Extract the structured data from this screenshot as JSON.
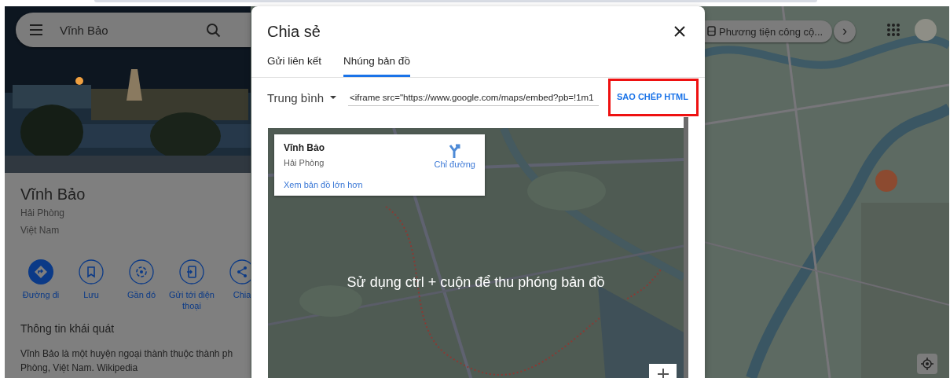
{
  "search": {
    "value": "Vĩnh Bảo"
  },
  "place": {
    "name": "Vĩnh Bảo",
    "lines": [
      "Hải Phòng",
      "Việt Nam"
    ]
  },
  "actions": [
    {
      "kind": "directions",
      "label": "Đường đi",
      "primary": true
    },
    {
      "kind": "save",
      "label": "Lưu",
      "primary": false
    },
    {
      "kind": "nearby",
      "label": "Gần đó",
      "primary": false
    },
    {
      "kind": "phone",
      "label": "Gửi tới điện thoại",
      "primary": false
    },
    {
      "kind": "share",
      "label": "Chia",
      "primary": false
    }
  ],
  "overview": {
    "title": "Thông tin khái quát",
    "lines": [
      "Vĩnh Bảo là một huyện ngoại thành thuộc thành ph",
      "Phòng, Việt Nam. Wikipedia"
    ]
  },
  "map_controls": {
    "transit_chip": "Phương tiện công cộ...",
    "next": "›"
  },
  "dialog": {
    "title": "Chia sẻ",
    "tabs": [
      {
        "label": "Gửi liên kết",
        "selected": false
      },
      {
        "label": "Nhúng bản đồ",
        "selected": true
      }
    ],
    "size": "Trung bình",
    "embed_code": "<iframe src=\"https://www.google.com/maps/embed?pb=!1m1",
    "copy_button": {
      "label": "SAO CHÉP HTML",
      "highlighted": true
    },
    "preview": {
      "kind": "picture",
      "card": {
        "title": "Vĩnh Bảo",
        "subtitle": "Hải Phòng",
        "directions": "Chỉ đường",
        "link": "Xem bản đồ lớn hơn"
      },
      "hint": "Sử dụng ctrl + cuộn để thu phóng bản đồ"
    }
  }
}
